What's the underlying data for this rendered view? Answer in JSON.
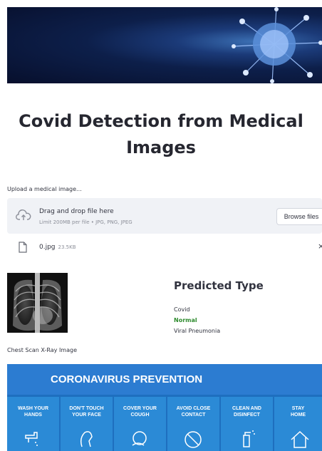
{
  "title": "Covid Detection from Medical Images",
  "uploader": {
    "label": "Upload a medical image...",
    "drop_text": "Drag and drop file here",
    "limit_text": "Limit 200MB per file • JPG, PNG, JPEG",
    "browse_label": "Browse files"
  },
  "file": {
    "name": "0.jpg",
    "size": "23.5KB",
    "close": "×"
  },
  "prediction": {
    "heading": "Predicted Type",
    "types": [
      "Covid",
      "Normal",
      "Viral Pneumonia"
    ],
    "selected_index": 1
  },
  "image_caption": "Chest Scan X-Ray Image",
  "poster": {
    "heading": "CORONAVIRUS PREVENTION",
    "tiles": [
      {
        "line1": "WASH YOUR",
        "line2": "HANDS",
        "icon": "faucet-icon"
      },
      {
        "line1": "DON'T TOUCH",
        "line2": "YOUR FACE",
        "icon": "face-icon"
      },
      {
        "line1": "COVER YOUR",
        "line2": "COUGH",
        "icon": "cough-icon"
      },
      {
        "line1": "AVOID CLOSE",
        "line2": "CONTACT",
        "icon": "no-contact-icon"
      },
      {
        "line1": "CLEAN AND",
        "line2": "DISINFECT",
        "icon": "spray-icon"
      },
      {
        "line1": "STAY",
        "line2": "HOME",
        "icon": "home-icon"
      }
    ]
  },
  "colors": {
    "accent_green": "#2e8b2e",
    "poster_blue": "#1e6fbf",
    "dropzone_bg": "#f0f2f6"
  }
}
